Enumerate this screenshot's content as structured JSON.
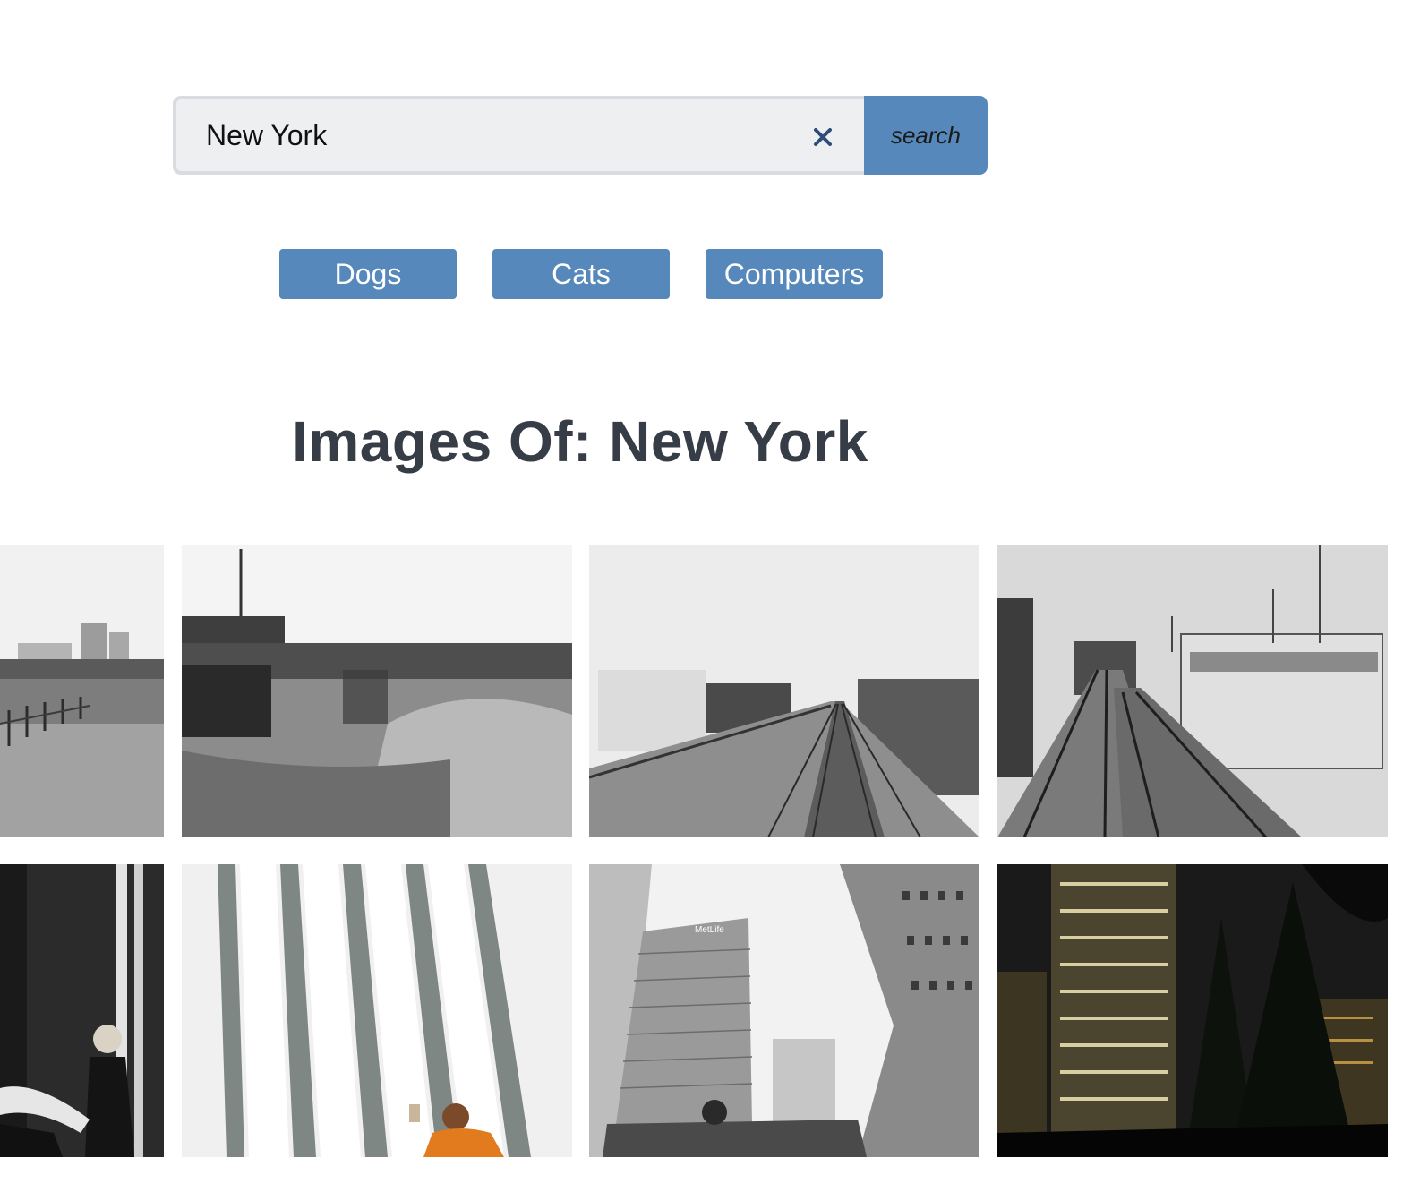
{
  "search": {
    "value": "New York",
    "button_label": "search",
    "clear_icon": "close-icon"
  },
  "topics": [
    {
      "label": "Dogs"
    },
    {
      "label": "Cats"
    },
    {
      "label": "Computers"
    }
  ],
  "results": {
    "heading": "Images Of: New York"
  },
  "colors": {
    "accent": "#5688bb",
    "heading": "#363d47",
    "input_bg": "#eeeff1",
    "clear_icon": "#2f4d7a"
  },
  "images": [
    {
      "name": "image-rail-yard-field"
    },
    {
      "name": "image-rail-yard-shacks"
    },
    {
      "name": "image-elevated-train"
    },
    {
      "name": "image-railroad-tracks"
    },
    {
      "name": "image-street-figures"
    },
    {
      "name": "image-white-ribs-selfie"
    },
    {
      "name": "image-metlife-building"
    },
    {
      "name": "image-night-skyscrapers"
    }
  ],
  "overlay_text": {
    "metlife_sign": "MetLife"
  }
}
